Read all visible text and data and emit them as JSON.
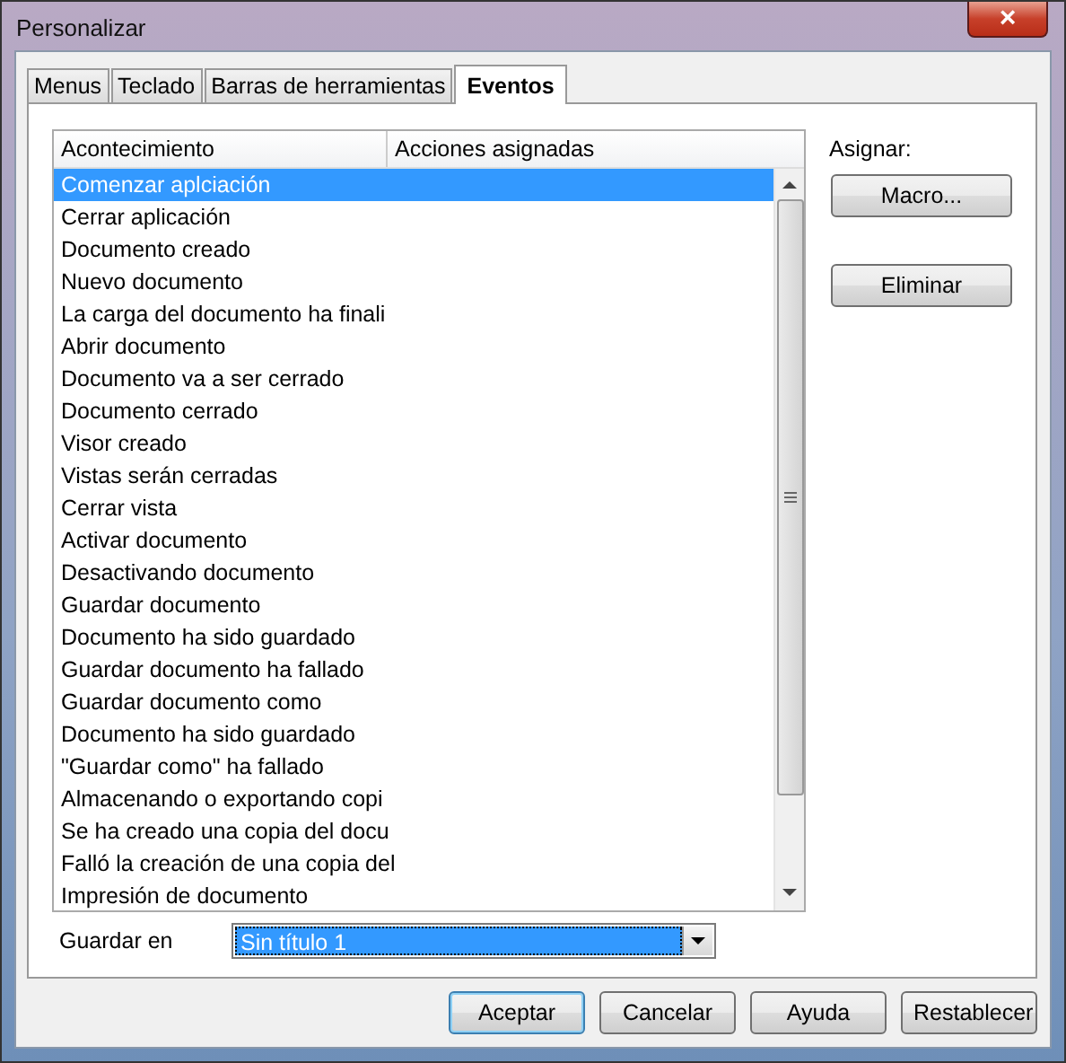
{
  "window": {
    "title": "Personalizar",
    "close": "×"
  },
  "tabs": [
    {
      "label": "Menus",
      "selected": false
    },
    {
      "label": "Teclado",
      "selected": false
    },
    {
      "label": "Barras de herramientas",
      "selected": false
    },
    {
      "label": "Eventos",
      "selected": true
    }
  ],
  "table": {
    "columns": [
      "Acontecimiento",
      "Acciones asignadas"
    ],
    "rows": [
      {
        "event": "Comenzar aplciación",
        "selected": true
      },
      {
        "event": "Cerrar aplicación",
        "selected": false
      },
      {
        "event": "Documento creado",
        "selected": false
      },
      {
        "event": "Nuevo documento",
        "selected": false
      },
      {
        "event": "La carga del documento ha finali",
        "selected": false
      },
      {
        "event": "Abrir documento",
        "selected": false
      },
      {
        "event": "Documento va a ser cerrado",
        "selected": false
      },
      {
        "event": "Documento cerrado",
        "selected": false
      },
      {
        "event": "Visor creado",
        "selected": false
      },
      {
        "event": "Vistas serán cerradas",
        "selected": false
      },
      {
        "event": "Cerrar vista",
        "selected": false
      },
      {
        "event": "Activar documento",
        "selected": false
      },
      {
        "event": "Desactivando documento",
        "selected": false
      },
      {
        "event": "Guardar documento",
        "selected": false
      },
      {
        "event": "Documento ha sido guardado",
        "selected": false
      },
      {
        "event": "Guardar documento ha fallado",
        "selected": false
      },
      {
        "event": "Guardar documento como",
        "selected": false
      },
      {
        "event": "Documento ha sido guardado",
        "selected": false
      },
      {
        "event": "\"Guardar como\" ha fallado",
        "selected": false
      },
      {
        "event": "Almacenando o exportando copi",
        "selected": false
      },
      {
        "event": "Se ha creado una copia del docu",
        "selected": false
      },
      {
        "event": "Falló la creación de una copia del",
        "selected": false
      },
      {
        "event": "Impresión de documento",
        "selected": false
      }
    ]
  },
  "assign": {
    "label": "Asignar:",
    "buttons": [
      "Macro...",
      "Eliminar"
    ]
  },
  "save_in": {
    "label": "Guardar en",
    "value": "Sin título 1"
  },
  "buttons": [
    {
      "label": "Aceptar",
      "default": true
    },
    {
      "label": "Cancelar",
      "default": false
    },
    {
      "label": "Ayuda",
      "default": false
    },
    {
      "label": "Restablecer",
      "default": false
    }
  ]
}
